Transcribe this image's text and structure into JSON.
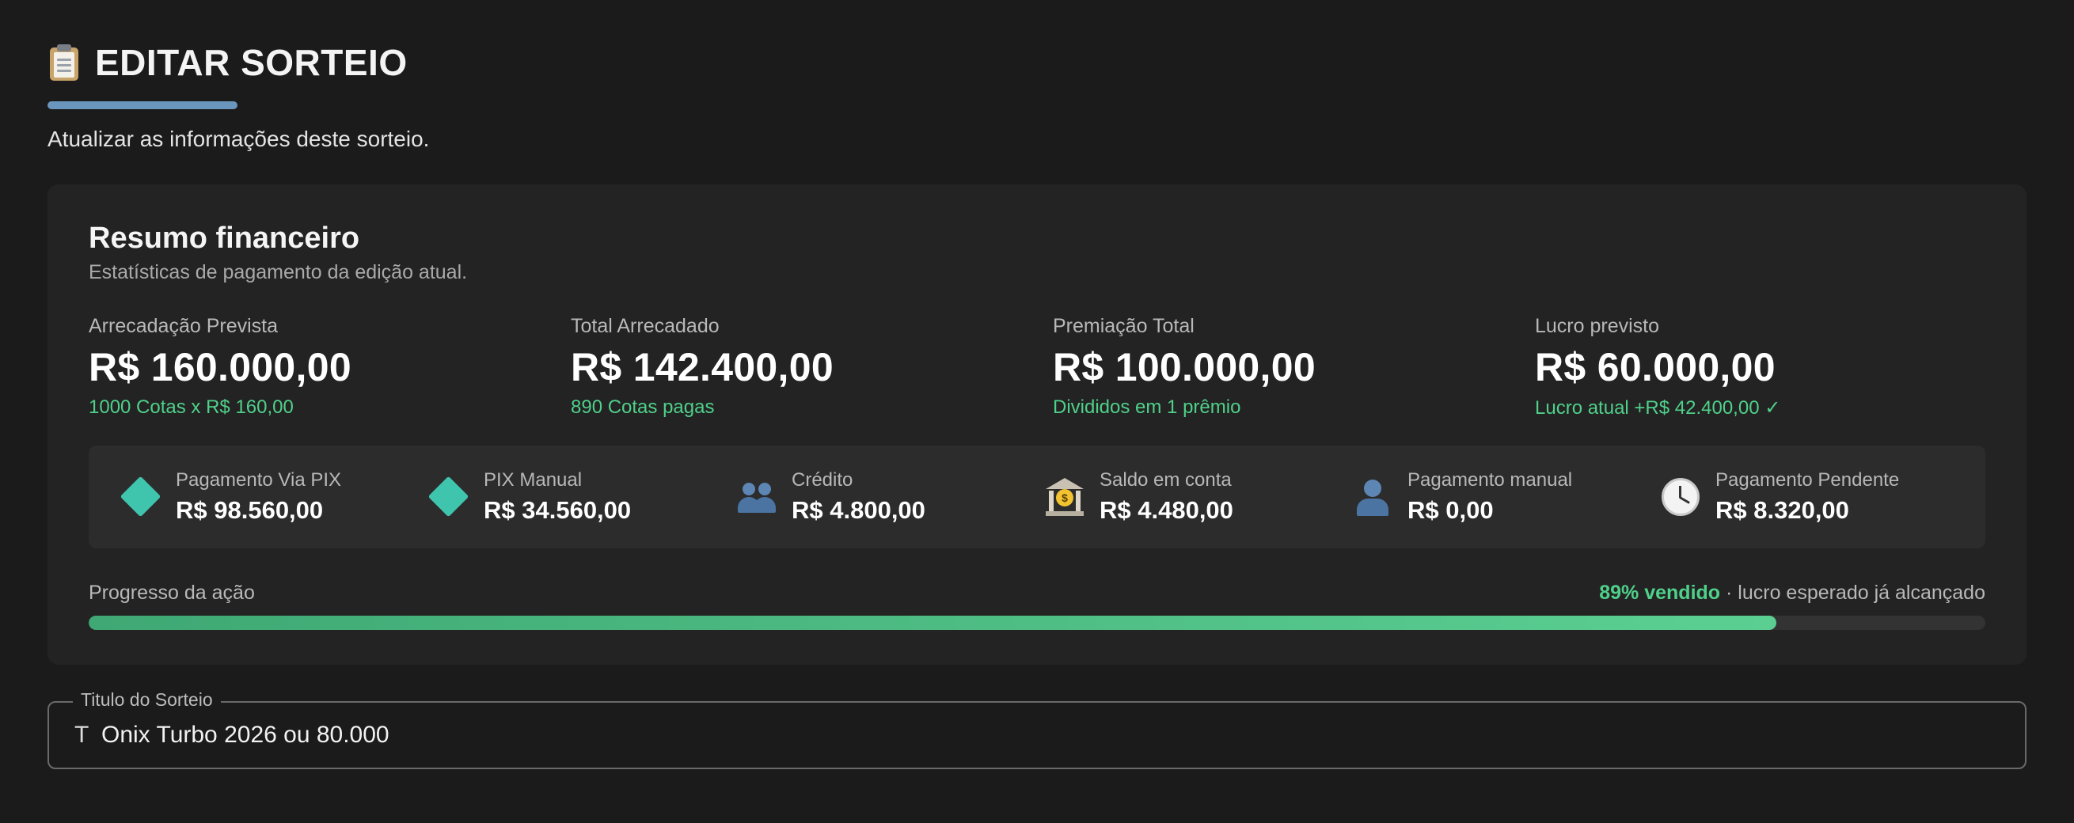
{
  "header": {
    "icon": "clipboard-icon",
    "title": "EDITAR SORTEIO",
    "subtitle": "Atualizar as informações deste sorteio.",
    "accent_color": "#6a95bd"
  },
  "summary": {
    "title": "Resumo financeiro",
    "subtitle": "Estatísticas de pagamento da edição atual.",
    "stats": [
      {
        "label": "Arrecadação Prevista",
        "value": "R$ 160.000,00",
        "note": "1000 Cotas x R$ 160,00"
      },
      {
        "label": "Total Arrecadado",
        "value": "R$ 142.400,00",
        "note": "890 Cotas pagas"
      },
      {
        "label": "Premiação Total",
        "value": "R$ 100.000,00",
        "note": "Divididos em 1 prêmio"
      },
      {
        "label": "Lucro previsto",
        "value": "R$ 60.000,00",
        "note": "Lucro atual +R$ 42.400,00 ✓"
      }
    ],
    "note_color": "#4fd08a",
    "payments": [
      {
        "icon": "pix-icon",
        "label": "Pagamento Via PIX",
        "value": "R$ 98.560,00"
      },
      {
        "icon": "pix-icon",
        "label": "PIX Manual",
        "value": "R$ 34.560,00"
      },
      {
        "icon": "users-icon",
        "label": "Crédito",
        "value": "R$ 4.800,00"
      },
      {
        "icon": "bank-icon",
        "label": "Saldo em conta",
        "value": "R$ 4.480,00"
      },
      {
        "icon": "user-icon",
        "label": "Pagamento manual",
        "value": "R$ 0,00"
      },
      {
        "icon": "clock-icon",
        "label": "Pagamento Pendente",
        "value": "R$ 8.320,00"
      }
    ],
    "progress": {
      "label": "Progresso da ação",
      "percent_text": "89% vendido",
      "status_text": " · lucro esperado já alcançado",
      "fraction": 0.89
    }
  },
  "title_field": {
    "label": "Titulo do Sorteio",
    "icon": "text-type-icon",
    "icon_glyph": "T",
    "value": "Onix Turbo 2026 ou 80.000"
  }
}
